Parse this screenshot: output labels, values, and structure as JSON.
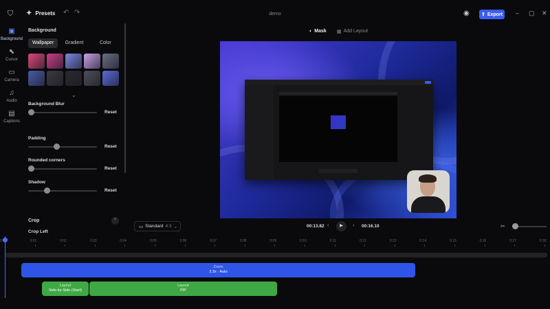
{
  "titlebar": {
    "presets_label": "Presets",
    "document_title": "demo",
    "export_label": "Export",
    "export_color": "#3b5cf2"
  },
  "rail": {
    "items": [
      {
        "label": "Background",
        "icon": "image-icon",
        "active": true
      },
      {
        "label": "Cursor",
        "icon": "cursor-icon"
      },
      {
        "label": "Camera",
        "icon": "camera-icon"
      },
      {
        "label": "Audio",
        "icon": "audio-icon"
      },
      {
        "label": "Captions",
        "icon": "captions-icon"
      }
    ]
  },
  "panel": {
    "title": "Background",
    "tabs": [
      "Wallpaper",
      "Gradient",
      "Color"
    ],
    "active_tab": "Wallpaper",
    "wallpapers": [
      "#d9477a",
      "#c83e88",
      "#7a86e0",
      "#c8a0e8",
      "#6a6c84",
      "#4a5aa8",
      "#3a3a40",
      "#2a2a2e",
      "#4c4f58",
      "#5a6ad8"
    ],
    "controls": [
      {
        "label": "Background Blur",
        "reset": "Reset",
        "level": 0.04
      },
      {
        "label": "Padding",
        "reset": "Reset",
        "level": 0.41
      },
      {
        "label": "Rounded corners",
        "reset": "Reset",
        "level": 0.04
      },
      {
        "label": "Shadow",
        "reset": "Reset",
        "level": 0.27
      }
    ],
    "crop_title": "Crop",
    "crop_left": "Crop Left"
  },
  "toolbar": {
    "mask_label": "Mask",
    "add_layout_label": "Add Layout"
  },
  "transport": {
    "aspect_label": "Standard",
    "aspect_ratio": "4:3",
    "current_time": "00:13.82",
    "end_time": "00:16.10"
  },
  "timeline": {
    "ruler": [
      "0:00",
      "0:01",
      "0:02",
      "0:03",
      "0:04",
      "0:05",
      "0:06",
      "0:07",
      "0:08",
      "0:09",
      "0:10",
      "0:11",
      "0:12",
      "0:13",
      "0:14",
      "0:15",
      "0:16",
      "0:17",
      "0:18"
    ],
    "zoom_clip": {
      "title": "Zoom",
      "detail": "2.3x · Auto"
    },
    "layout_clips": [
      {
        "title": "Layout",
        "detail": "Side-by-Side (Start)"
      },
      {
        "title": "Layout",
        "detail": "PIP"
      }
    ]
  }
}
